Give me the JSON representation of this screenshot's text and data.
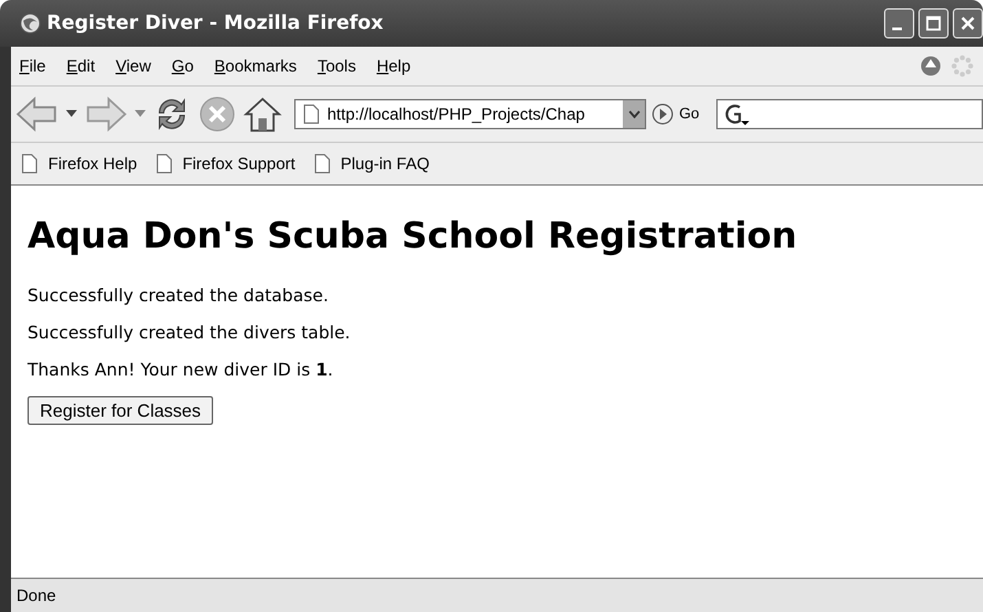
{
  "window": {
    "title": "Register Diver - Mozilla Firefox"
  },
  "menu": [
    "File",
    "Edit",
    "View",
    "Go",
    "Bookmarks",
    "Tools",
    "Help"
  ],
  "toolbar": {
    "address": "http://localhost/PHP_Projects/Chap",
    "go": "Go"
  },
  "bookmarks": [
    "Firefox Help",
    "Firefox Support",
    "Plug-in FAQ"
  ],
  "page": {
    "heading": "Aqua Don's Scuba School Registration",
    "messages": [
      "Successfully created the database.",
      "Successfully created the divers table.",
      "Thanks Ann! Your new diver ID is **1**."
    ],
    "button": "Register for Classes"
  },
  "status_bar": {
    "text": "Done"
  }
}
